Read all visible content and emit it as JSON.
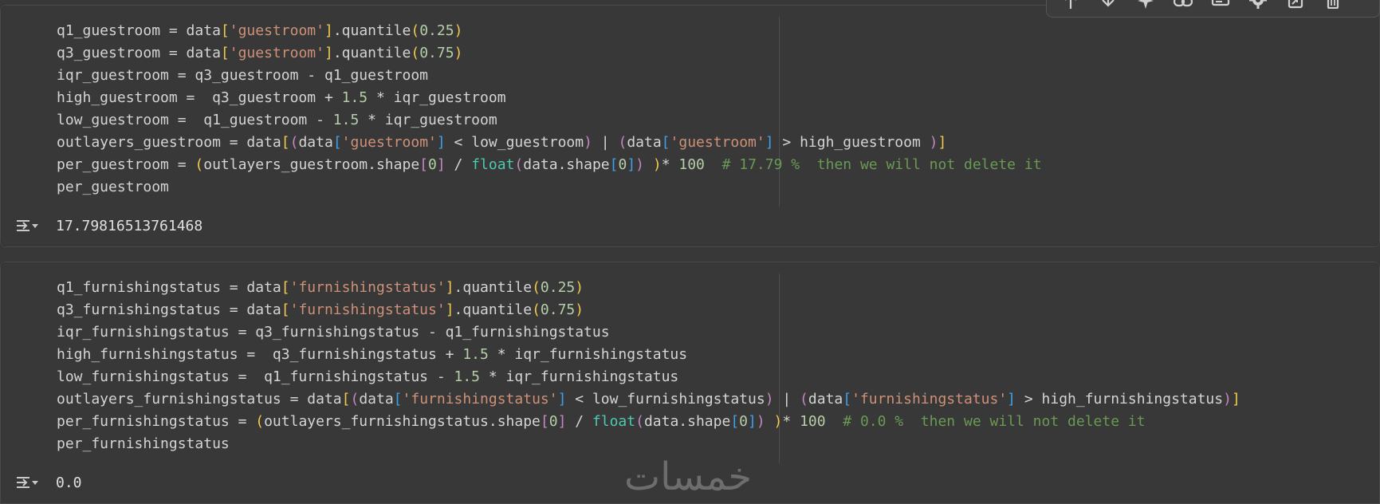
{
  "cell1": {
    "output_value": "17.79816513761468"
  },
  "cell2": {
    "output_value": "0.0"
  },
  "code_text": {
    "c1_l1_a": "q1_guestroom = data",
    "c1_l1_s": "'guestroom'",
    "c1_l1_b": ".quantile",
    "c1_l1_n": "0.25",
    "c1_l2_a": "q3_guestroom = data",
    "c1_l2_s": "'guestroom'",
    "c1_l2_b": ".quantile",
    "c1_l2_n": "0.75",
    "c1_l3": "iqr_guestroom = q3_guestroom - q1_guestroom",
    "c1_l4_a": "high_guestroom =  q3_guestroom + ",
    "c1_l4_n": "1.5",
    "c1_l4_b": " * iqr_guestroom",
    "c1_l5_a": "low_guestroom =  q1_guestroom - ",
    "c1_l5_n": "1.5",
    "c1_l5_b": " * iqr_guestroom",
    "c1_l6_a": "outlayers_guestroom = data",
    "c1_l6_s1": "'guestroom'",
    "c1_l6_b": " < low_guestroom",
    "c1_l6_c": " | ",
    "c1_l6_s2": "'guestroom'",
    "c1_l6_d": " > high_guestroom ",
    "c1_l7_a": "per_guestroom = ",
    "c1_l7_b": "outlayers_guestroom.shape",
    "c1_l7_n0": "0",
    "c1_l7_c": " / ",
    "c1_l7_fn": "float",
    "c1_l7_d": "data.shape",
    "c1_l7_n1": "0",
    "c1_l7_e": "* ",
    "c1_l7_n2": "100",
    "c1_l7_cm": "  # 17.79 %  then we will not delete it",
    "c1_l8": "per_guestroom",
    "c2_l1_a": "q1_furnishingstatus = data",
    "c2_l1_s": "'furnishingstatus'",
    "c2_l1_b": ".quantile",
    "c2_l1_n": "0.25",
    "c2_l2_a": "q3_furnishingstatus = data",
    "c2_l2_s": "'furnishingstatus'",
    "c2_l2_b": ".quantile",
    "c2_l2_n": "0.75",
    "c2_l3": "iqr_furnishingstatus = q3_furnishingstatus - q1_furnishingstatus",
    "c2_l4_a": "high_furnishingstatus =  q3_furnishingstatus + ",
    "c2_l4_n": "1.5",
    "c2_l4_b": " * iqr_furnishingstatus",
    "c2_l5_a": "low_furnishingstatus =  q1_furnishingstatus - ",
    "c2_l5_n": "1.5",
    "c2_l5_b": " * iqr_furnishingstatus",
    "c2_l6_a": "outlayers_furnishingstatus = data",
    "c2_l6_s1": "'furnishingstatus'",
    "c2_l6_b": " < low_furnishingstatus",
    "c2_l6_c": " | ",
    "c2_l6_s2": "'furnishingstatus'",
    "c2_l6_d": " > high_furnishingstatus",
    "c2_l7_a": "per_furnishingstatus = ",
    "c2_l7_b": "outlayers_furnishingstatus.shape",
    "c2_l7_n0": "0",
    "c2_l7_c": " / ",
    "c2_l7_fn": "float",
    "c2_l7_d": "data.shape",
    "c2_l7_n1": "0",
    "c2_l7_e": "* ",
    "c2_l7_n2": "100",
    "c2_l7_cm": "  # 0.0 %  then we will not delete it",
    "c2_l8": "per_furnishingstatus"
  },
  "toolbar": {
    "icons": [
      "arrow-up-icon",
      "arrow-down-icon",
      "sparkle-icon",
      "link-icon",
      "comment-icon",
      "gear-icon",
      "mirror-cell-icon",
      "trash-icon"
    ]
  },
  "watermark": {
    "text": "خمسات"
  },
  "colors": {
    "background": "#383838",
    "string": "#ce9178",
    "number": "#b5cea8",
    "bracket_level1": "#f2c94c",
    "bracket_level2": "#c586c0",
    "bracket_level3": "#3f9ee8",
    "builtin": "#4ec9b0",
    "comment": "#6a9955"
  }
}
